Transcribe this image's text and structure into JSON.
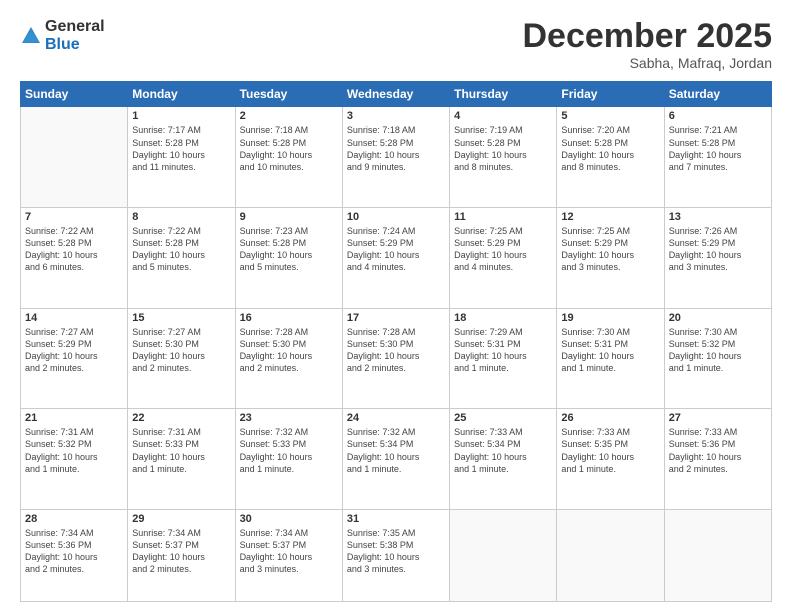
{
  "logo": {
    "general": "General",
    "blue": "Blue"
  },
  "header": {
    "month": "December 2025",
    "location": "Sabha, Mafraq, Jordan"
  },
  "days_of_week": [
    "Sunday",
    "Monday",
    "Tuesday",
    "Wednesday",
    "Thursday",
    "Friday",
    "Saturday"
  ],
  "weeks": [
    [
      {
        "num": "",
        "info": ""
      },
      {
        "num": "1",
        "info": "Sunrise: 7:17 AM\nSunset: 5:28 PM\nDaylight: 10 hours\nand 11 minutes."
      },
      {
        "num": "2",
        "info": "Sunrise: 7:18 AM\nSunset: 5:28 PM\nDaylight: 10 hours\nand 10 minutes."
      },
      {
        "num": "3",
        "info": "Sunrise: 7:18 AM\nSunset: 5:28 PM\nDaylight: 10 hours\nand 9 minutes."
      },
      {
        "num": "4",
        "info": "Sunrise: 7:19 AM\nSunset: 5:28 PM\nDaylight: 10 hours\nand 8 minutes."
      },
      {
        "num": "5",
        "info": "Sunrise: 7:20 AM\nSunset: 5:28 PM\nDaylight: 10 hours\nand 8 minutes."
      },
      {
        "num": "6",
        "info": "Sunrise: 7:21 AM\nSunset: 5:28 PM\nDaylight: 10 hours\nand 7 minutes."
      }
    ],
    [
      {
        "num": "7",
        "info": "Sunrise: 7:22 AM\nSunset: 5:28 PM\nDaylight: 10 hours\nand 6 minutes."
      },
      {
        "num": "8",
        "info": "Sunrise: 7:22 AM\nSunset: 5:28 PM\nDaylight: 10 hours\nand 5 minutes."
      },
      {
        "num": "9",
        "info": "Sunrise: 7:23 AM\nSunset: 5:28 PM\nDaylight: 10 hours\nand 5 minutes."
      },
      {
        "num": "10",
        "info": "Sunrise: 7:24 AM\nSunset: 5:29 PM\nDaylight: 10 hours\nand 4 minutes."
      },
      {
        "num": "11",
        "info": "Sunrise: 7:25 AM\nSunset: 5:29 PM\nDaylight: 10 hours\nand 4 minutes."
      },
      {
        "num": "12",
        "info": "Sunrise: 7:25 AM\nSunset: 5:29 PM\nDaylight: 10 hours\nand 3 minutes."
      },
      {
        "num": "13",
        "info": "Sunrise: 7:26 AM\nSunset: 5:29 PM\nDaylight: 10 hours\nand 3 minutes."
      }
    ],
    [
      {
        "num": "14",
        "info": "Sunrise: 7:27 AM\nSunset: 5:29 PM\nDaylight: 10 hours\nand 2 minutes."
      },
      {
        "num": "15",
        "info": "Sunrise: 7:27 AM\nSunset: 5:30 PM\nDaylight: 10 hours\nand 2 minutes."
      },
      {
        "num": "16",
        "info": "Sunrise: 7:28 AM\nSunset: 5:30 PM\nDaylight: 10 hours\nand 2 minutes."
      },
      {
        "num": "17",
        "info": "Sunrise: 7:28 AM\nSunset: 5:30 PM\nDaylight: 10 hours\nand 2 minutes."
      },
      {
        "num": "18",
        "info": "Sunrise: 7:29 AM\nSunset: 5:31 PM\nDaylight: 10 hours\nand 1 minute."
      },
      {
        "num": "19",
        "info": "Sunrise: 7:30 AM\nSunset: 5:31 PM\nDaylight: 10 hours\nand 1 minute."
      },
      {
        "num": "20",
        "info": "Sunrise: 7:30 AM\nSunset: 5:32 PM\nDaylight: 10 hours\nand 1 minute."
      }
    ],
    [
      {
        "num": "21",
        "info": "Sunrise: 7:31 AM\nSunset: 5:32 PM\nDaylight: 10 hours\nand 1 minute."
      },
      {
        "num": "22",
        "info": "Sunrise: 7:31 AM\nSunset: 5:33 PM\nDaylight: 10 hours\nand 1 minute."
      },
      {
        "num": "23",
        "info": "Sunrise: 7:32 AM\nSunset: 5:33 PM\nDaylight: 10 hours\nand 1 minute."
      },
      {
        "num": "24",
        "info": "Sunrise: 7:32 AM\nSunset: 5:34 PM\nDaylight: 10 hours\nand 1 minute."
      },
      {
        "num": "25",
        "info": "Sunrise: 7:33 AM\nSunset: 5:34 PM\nDaylight: 10 hours\nand 1 minute."
      },
      {
        "num": "26",
        "info": "Sunrise: 7:33 AM\nSunset: 5:35 PM\nDaylight: 10 hours\nand 1 minute."
      },
      {
        "num": "27",
        "info": "Sunrise: 7:33 AM\nSunset: 5:36 PM\nDaylight: 10 hours\nand 2 minutes."
      }
    ],
    [
      {
        "num": "28",
        "info": "Sunrise: 7:34 AM\nSunset: 5:36 PM\nDaylight: 10 hours\nand 2 minutes."
      },
      {
        "num": "29",
        "info": "Sunrise: 7:34 AM\nSunset: 5:37 PM\nDaylight: 10 hours\nand 2 minutes."
      },
      {
        "num": "30",
        "info": "Sunrise: 7:34 AM\nSunset: 5:37 PM\nDaylight: 10 hours\nand 3 minutes."
      },
      {
        "num": "31",
        "info": "Sunrise: 7:35 AM\nSunset: 5:38 PM\nDaylight: 10 hours\nand 3 minutes."
      },
      {
        "num": "",
        "info": ""
      },
      {
        "num": "",
        "info": ""
      },
      {
        "num": "",
        "info": ""
      }
    ]
  ]
}
